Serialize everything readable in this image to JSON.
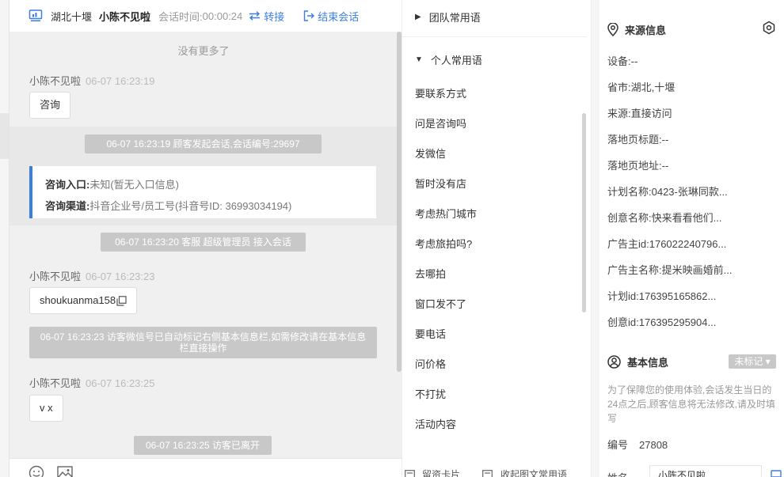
{
  "header": {
    "location": "湖北十堰",
    "visitor_name": "小陈不见啦",
    "duration_label": "会话时间:",
    "duration_value": "00:00:24",
    "transfer_label": "转接",
    "end_label": "结束会话"
  },
  "chat": {
    "no_more": "没有更多了",
    "messages": [
      {
        "sender": "小陈不见啦",
        "time": "06-07 16:23:19",
        "text": "咨询"
      },
      {
        "sender": "小陈不见啦",
        "time": "06-07 16:23:23",
        "text": "shoukuanma158"
      },
      {
        "sender": "小陈不见啦",
        "time": "06-07 16:23:25",
        "text": "v x"
      }
    ],
    "system": [
      "06-07 16:23:19 顾客发起会话,会话编号:29697",
      "06-07 16:23:20 客服 超级管理员 接入会话",
      "06-07 16:23:23 访客微信号已自动标记右侧基本信息栏,如需修改请在基本信息栏直接操作",
      "06-07 16:23:25 访客已离开"
    ],
    "info_card": {
      "entry_label": "咨询入口:",
      "entry_value": "未知(暂无入口信息)",
      "channel_label": "咨询渠道:",
      "channel_value": "抖音企业号/员工号(抖音号ID: 36993034194)"
    }
  },
  "phrases": {
    "team_group": "团队常用语",
    "personal_group": "个人常用语",
    "items": [
      "要联系方式",
      "问是咨询吗",
      "发微信",
      "暂时没有店",
      "考虑热门城市",
      "考虑旅拍吗?",
      "去哪拍",
      "窗口发不了",
      "要电话",
      "问价格",
      "不打扰",
      "活动内容"
    ],
    "footer_card": "留资卡片",
    "footer_collapse": "收起图文常用语"
  },
  "source_info": {
    "title": "来源信息",
    "fields": [
      "设备:--",
      "省市:湖北,十堰",
      "来源:直接访问",
      "落地页标题:--",
      "落地页地址:--",
      "计划名称:0423-张琳同款...",
      "创意名称:快来看看他们...",
      "广告主id:176022240796...",
      "广告主名称:提米映画婚前...",
      "计划id:176395165862...",
      "创意id:176395295904..."
    ]
  },
  "basic_info": {
    "title": "基本信息",
    "tag": "未标记 ▾",
    "hint": "为了保障您的使用体验,会话发生当日的24点之后,顾客信息将无法修改,请及时填写",
    "id_label": "编号",
    "id_value": "27808",
    "name_label": "姓名",
    "name_value": "小陈不见啦"
  }
}
